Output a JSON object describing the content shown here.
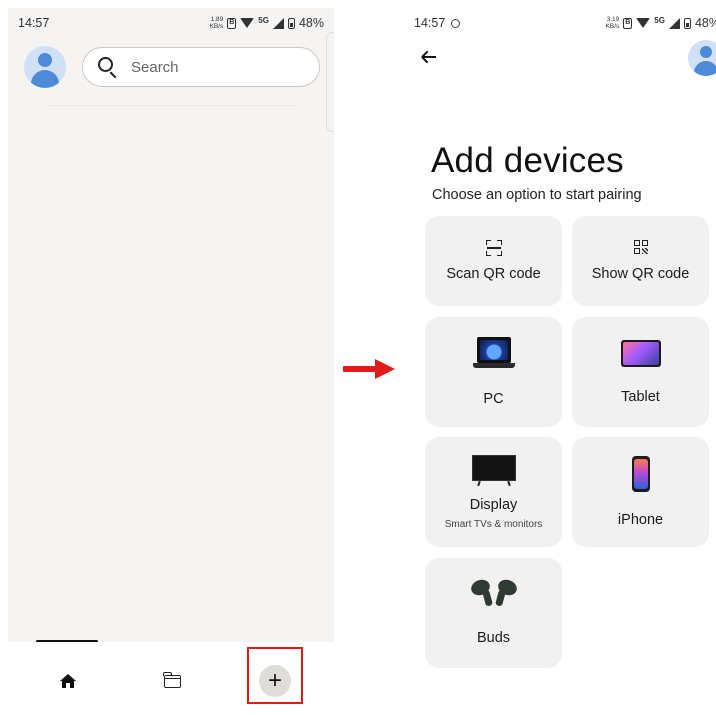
{
  "left_screen": {
    "status": {
      "time": "14:57",
      "speed_value": "1.89",
      "speed_unit": "KB/s",
      "network": "5G",
      "battery": "48%"
    },
    "search": {
      "placeholder": "Search"
    },
    "bottom_nav": [
      {
        "name": "home",
        "icon": "home-icon"
      },
      {
        "name": "files",
        "icon": "folder-icon"
      },
      {
        "name": "add",
        "icon": "plus-icon",
        "glyph": "+"
      }
    ]
  },
  "arrow_color": "#e21a1a",
  "highlight_color": "#e01b1b",
  "right_screen": {
    "status": {
      "time": "14:57",
      "speed_value": "3.19",
      "speed_unit": "KB/s",
      "network": "5G",
      "battery": "48%"
    },
    "title": "Add devices",
    "subtitle": "Choose an option to start pairing",
    "options": [
      {
        "label": "Scan QR code",
        "icon": "scan-qr-icon"
      },
      {
        "label": "Show QR code",
        "icon": "qr-code-icon"
      },
      {
        "label": "PC",
        "icon": "laptop-icon"
      },
      {
        "label": "Tablet",
        "icon": "tablet-icon"
      },
      {
        "label": "Display",
        "sublabel": "Smart TVs & monitors",
        "icon": "tv-icon"
      },
      {
        "label": "iPhone",
        "icon": "phone-icon"
      },
      {
        "label": "Buds",
        "icon": "earbuds-icon"
      }
    ]
  }
}
